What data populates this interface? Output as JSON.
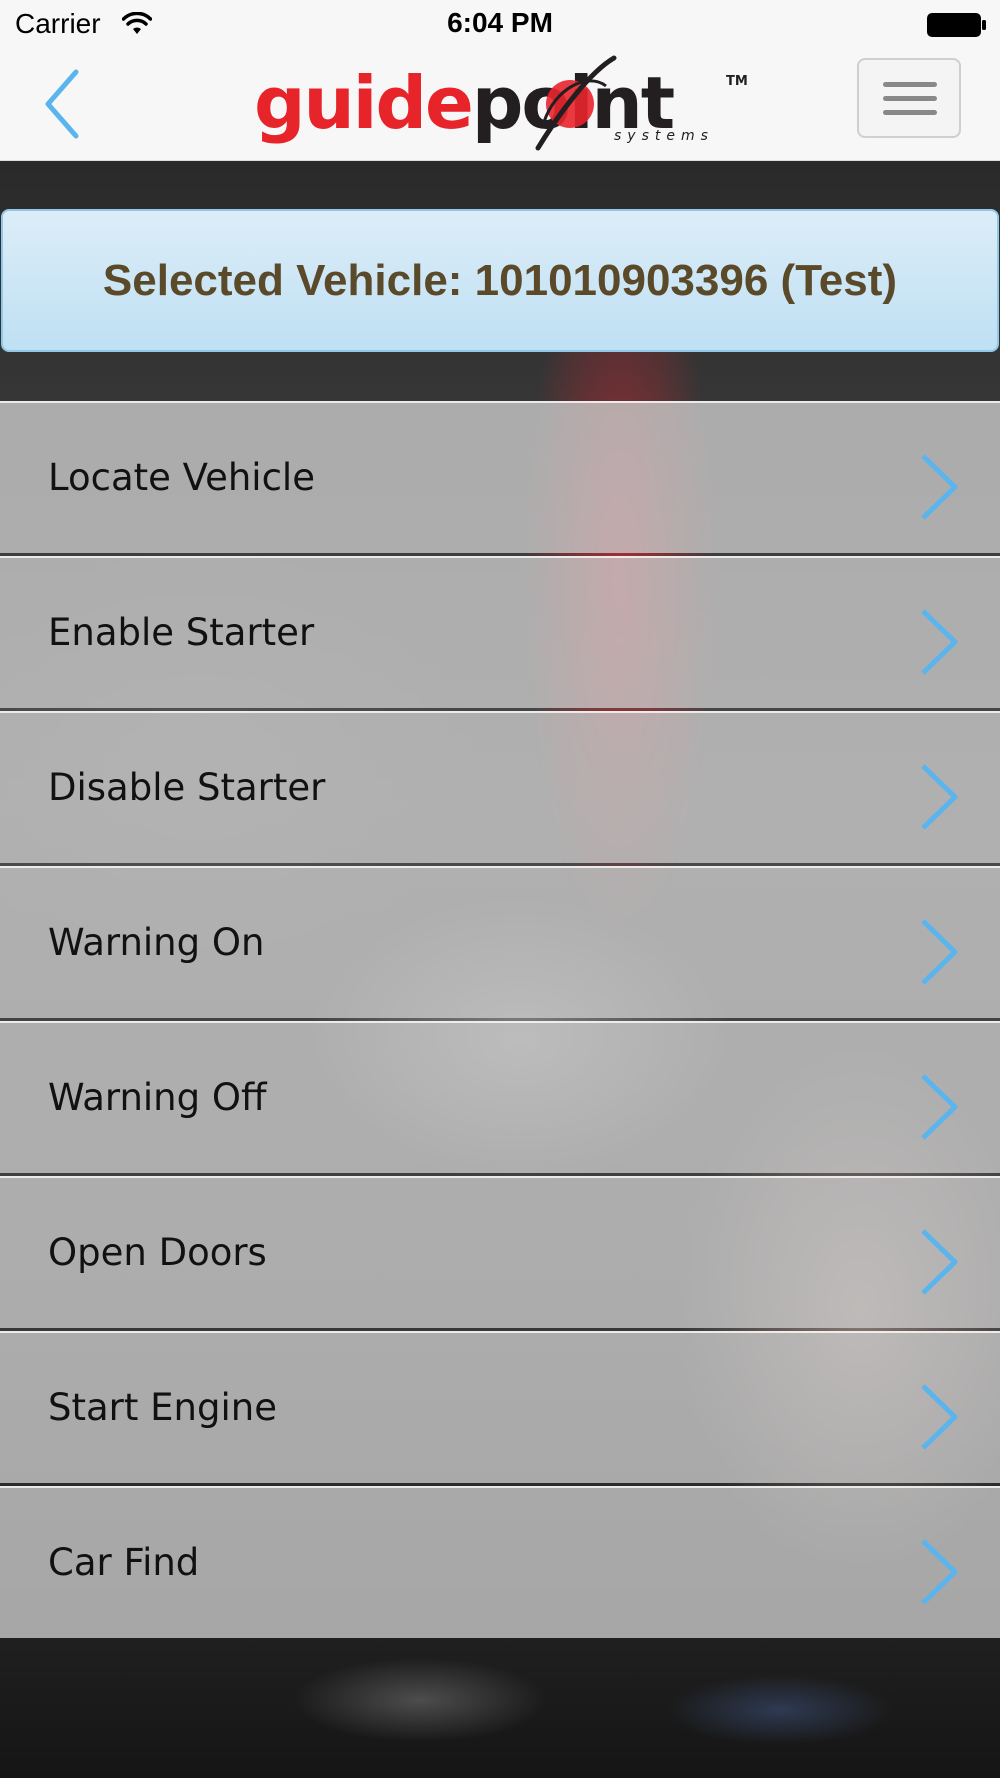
{
  "status_bar": {
    "carrier": "Carrier",
    "time": "6:04 PM"
  },
  "header": {
    "logo_part1": "guide",
    "logo_part2": "point",
    "logo_tm": "TM",
    "logo_sub": "systems",
    "back_icon": "chevron-left-icon",
    "menu_icon": "hamburger-menu-icon"
  },
  "banner": {
    "text": "Selected Vehicle: 101010903396 (Test)"
  },
  "menu": {
    "items": [
      {
        "label": "Locate Vehicle"
      },
      {
        "label": "Enable Starter"
      },
      {
        "label": "Disable Starter"
      },
      {
        "label": "Warning On"
      },
      {
        "label": "Warning Off"
      },
      {
        "label": "Open Doors"
      },
      {
        "label": "Start Engine"
      },
      {
        "label": "Car Find"
      }
    ]
  },
  "colors": {
    "accent": "#5ab4ee",
    "brand_red": "#e8242b",
    "banner_text": "#5a4a2a"
  }
}
